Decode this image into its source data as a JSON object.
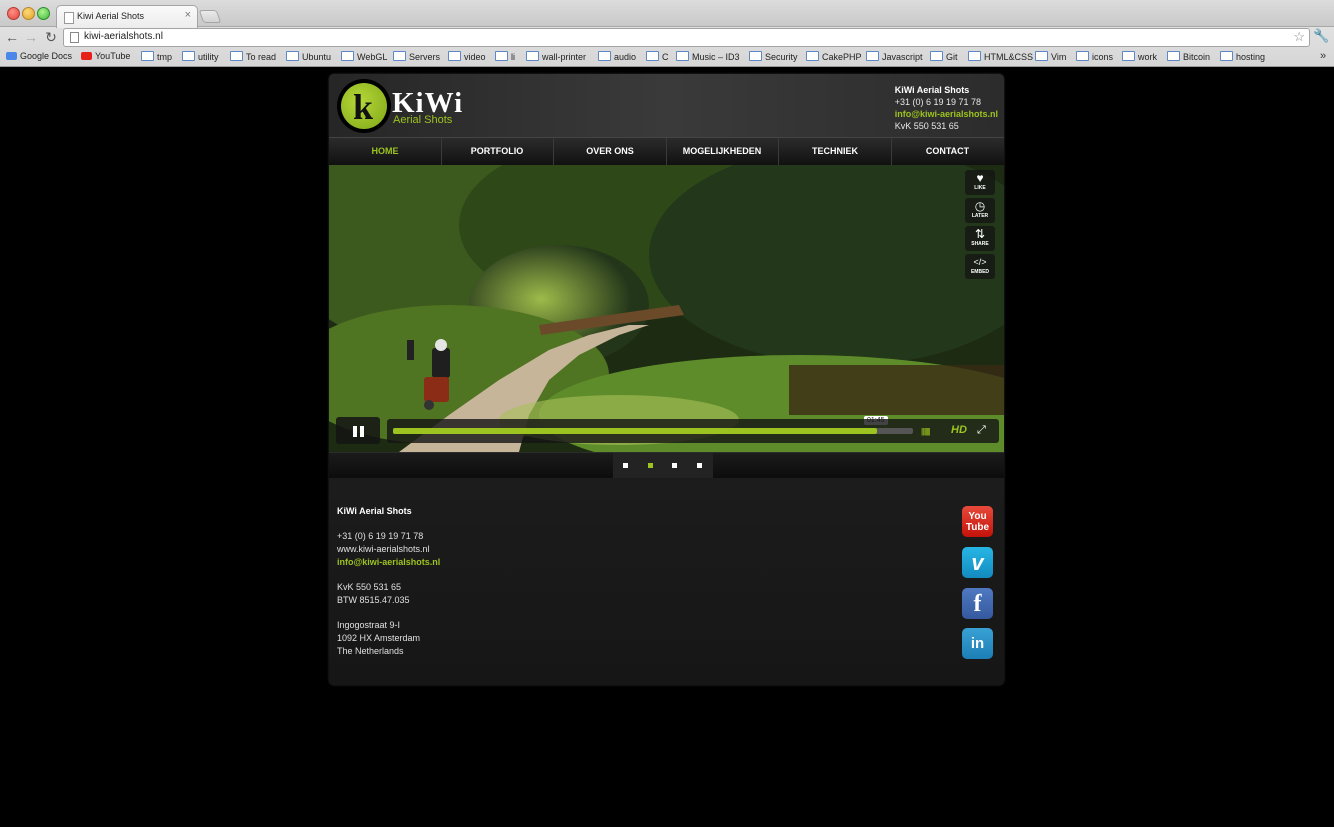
{
  "browser": {
    "tab_title": "Kiwi Aerial Shots",
    "tab_close": "×",
    "url": "kiwi-aerialshots.nl",
    "bookmarks": [
      {
        "label": "Google Docs",
        "icon": "gdocs-icon"
      },
      {
        "label": "YouTube",
        "icon": "youtube-icon"
      },
      {
        "label": "tmp",
        "icon": "folder-icon"
      },
      {
        "label": "utility",
        "icon": "folder-icon"
      },
      {
        "label": "To read",
        "icon": "folder-icon"
      },
      {
        "label": "Ubuntu",
        "icon": "folder-icon"
      },
      {
        "label": "WebGL",
        "icon": "folder-icon"
      },
      {
        "label": "Servers",
        "icon": "folder-icon"
      },
      {
        "label": "video",
        "icon": "folder-icon"
      },
      {
        "label": "li",
        "icon": "folder-icon"
      },
      {
        "label": "wall-printer",
        "icon": "folder-icon"
      },
      {
        "label": "audio",
        "icon": "folder-icon"
      },
      {
        "label": "C",
        "icon": "folder-icon"
      },
      {
        "label": "Music – ID3",
        "icon": "folder-icon"
      },
      {
        "label": "Security",
        "icon": "folder-icon"
      },
      {
        "label": "CakePHP",
        "icon": "folder-icon"
      },
      {
        "label": "Javascript",
        "icon": "folder-icon"
      },
      {
        "label": "Git",
        "icon": "folder-icon"
      },
      {
        "label": "HTML&CSS",
        "icon": "folder-icon"
      },
      {
        "label": "Vim",
        "icon": "folder-icon"
      },
      {
        "label": "icons",
        "icon": "folder-icon"
      },
      {
        "label": "work",
        "icon": "folder-icon"
      },
      {
        "label": "Bitcoin",
        "icon": "folder-icon"
      },
      {
        "label": "hosting",
        "icon": "folder-icon"
      }
    ],
    "bookmarks_more": "»"
  },
  "site": {
    "logo": {
      "word": "KiWi",
      "sub": "Aerial Shots"
    },
    "header_info": {
      "name": "KiWi Aerial Shots",
      "phone": "+31 (0) 6 19 19 71 78",
      "email": "info@kiwi-aerialshots.nl",
      "kvk": "KvK 550 531 65"
    },
    "menu": [
      "HOME",
      "PORTFOLIO",
      "OVER ONS",
      "MOGELIJKHEDEN",
      "TECHNIEK",
      "CONTACT"
    ],
    "video": {
      "tools": [
        {
          "label": "LIKE",
          "icon": "heart-icon",
          "glyph": "♥"
        },
        {
          "label": "LATER",
          "icon": "clock-icon",
          "glyph": "◷"
        },
        {
          "label": "SHARE",
          "icon": "share-icon",
          "glyph": "⇅"
        },
        {
          "label": "EMBED",
          "icon": "embed-icon",
          "glyph": "</>"
        }
      ],
      "time": "01:45",
      "progress": 0.93,
      "volume_glyph": "||||||||",
      "hd": "HD",
      "fullscreen_glyph": "⤢"
    },
    "slider_dots": {
      "count": 4,
      "active": 1
    },
    "footer": {
      "name": "KiWi Aerial Shots",
      "phone": "+31 (0) 6 19 19 71 78",
      "web": "www.kiwi-aerialshots.nl",
      "email": "info@kiwi-aerialshots.nl",
      "kvk": "KvK 550 531 65",
      "btw": "BTW 8515.47.035",
      "street": "Ingogostraat 9-I",
      "city": "1092 HX Amsterdam",
      "country": "The Netherlands"
    },
    "social": {
      "youtube_top": "You",
      "youtube_bottom": "Tube",
      "vimeo": "v",
      "facebook": "f",
      "linkedin": "in"
    },
    "colors": {
      "accent": "#9cc320",
      "background": "#000000"
    }
  }
}
